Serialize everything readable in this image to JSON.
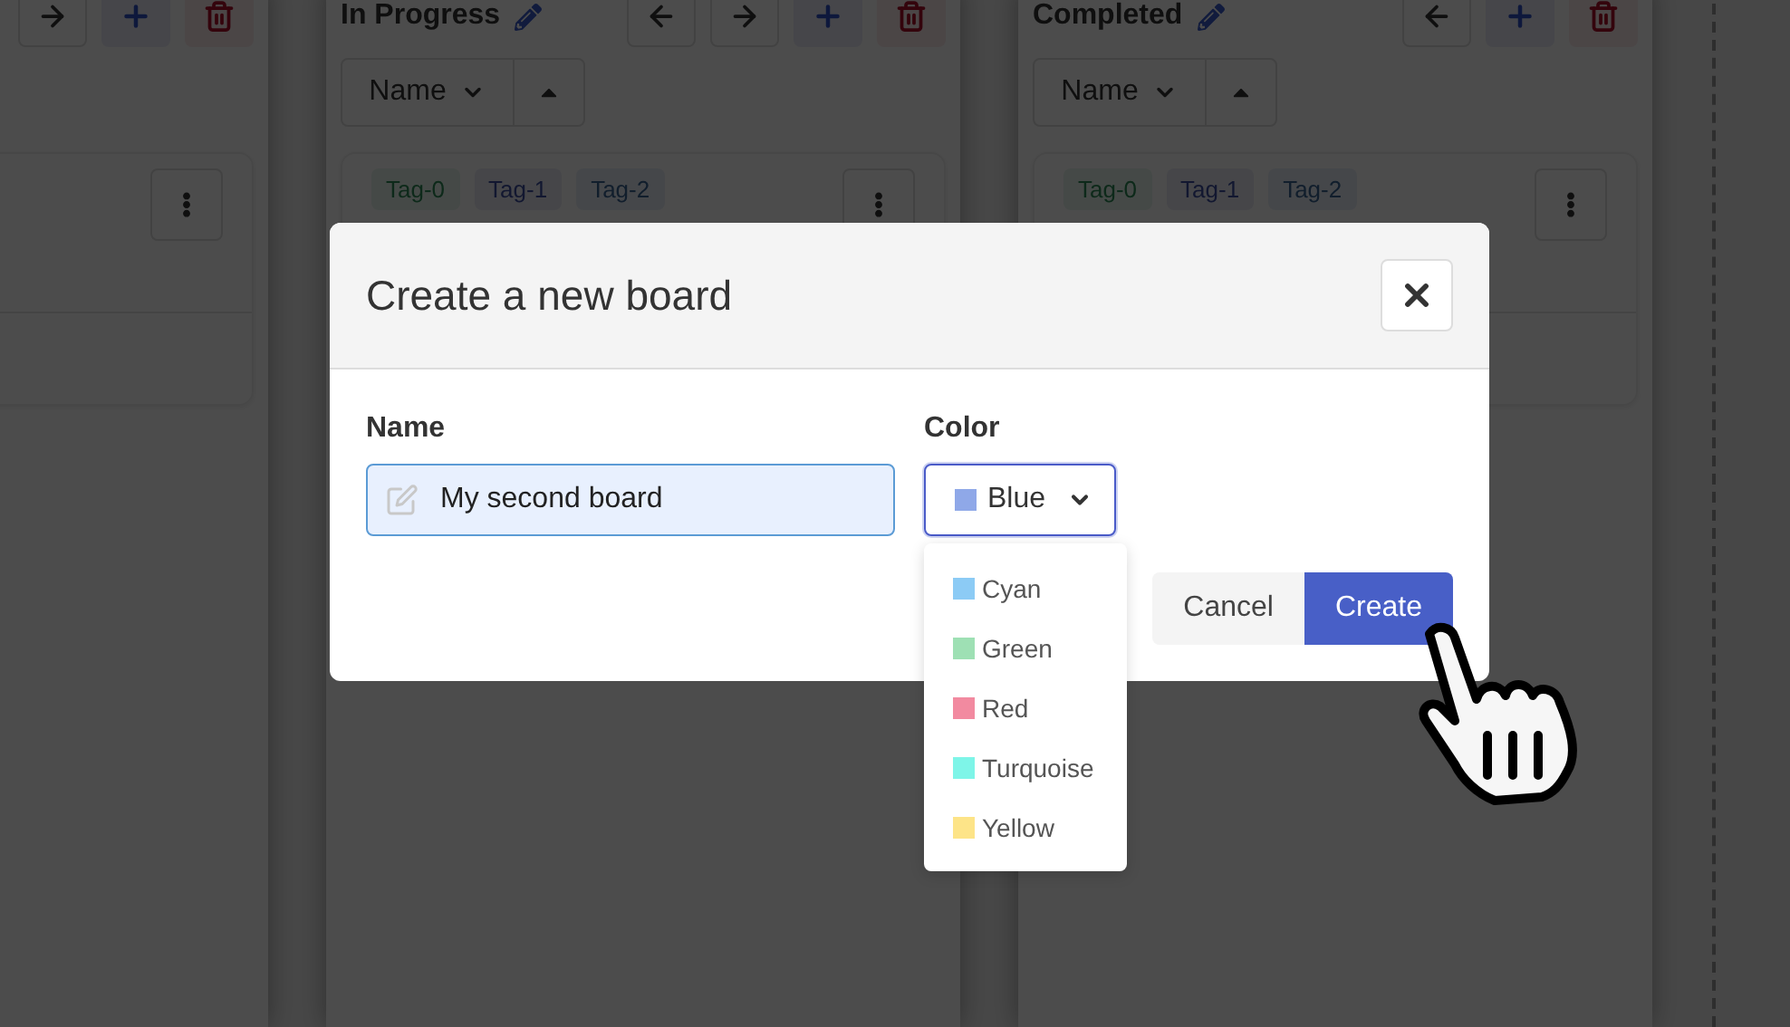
{
  "board": {
    "columns": [
      {
        "buttons": [
          {
            "kind": "right"
          },
          {
            "kind": "add"
          },
          {
            "kind": "delete"
          }
        ]
      },
      {
        "title": "In Progress",
        "buttons": [
          {
            "kind": "left"
          },
          {
            "kind": "right"
          },
          {
            "kind": "add"
          },
          {
            "kind": "delete"
          }
        ],
        "sort": {
          "field": "Name"
        },
        "tags": [
          "Tag-0",
          "Tag-1",
          "Tag-2"
        ]
      },
      {
        "title": "Completed",
        "buttons": [
          {
            "kind": "left"
          },
          {
            "kind": "add"
          },
          {
            "kind": "delete"
          }
        ],
        "sort": {
          "field": "Name"
        },
        "tags": [
          "Tag-0",
          "Tag-1",
          "Tag-2"
        ]
      }
    ]
  },
  "dialog": {
    "title": "Create a new board",
    "fields": [
      {
        "kind": "text",
        "label": "Name",
        "value": "My second board"
      },
      {
        "kind": "select",
        "label": "Color",
        "value": "Blue",
        "color": "#8fa8e8",
        "expanded": true,
        "options": [
          {
            "label": "Cyan",
            "color": "#8ccbf5"
          },
          {
            "label": "Green",
            "color": "#9ee0b4"
          },
          {
            "label": "Red",
            "color": "#f28aa0"
          },
          {
            "label": "Turquoise",
            "color": "#7ef5e8"
          },
          {
            "label": "Yellow",
            "color": "#fde488"
          }
        ]
      }
    ],
    "buttons": [
      {
        "kind": "secondary",
        "label": "Cancel"
      },
      {
        "kind": "primary",
        "label": "Create"
      }
    ]
  }
}
